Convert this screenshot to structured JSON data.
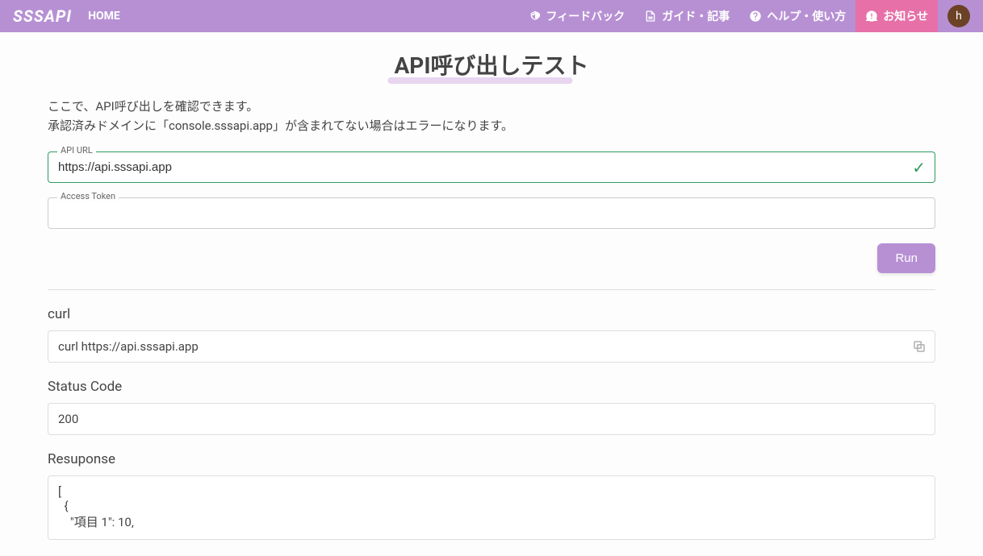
{
  "header": {
    "logo": "SSSAPI",
    "home": "HOME",
    "nav": {
      "feedback": "フィードバック",
      "guide": "ガイド・記事",
      "help": "ヘルプ・使い方",
      "news": "お知らせ"
    },
    "avatar_letter": "h"
  },
  "page": {
    "title": "API呼び出しテスト",
    "desc_line1": "ここで、API呼び出しを確認できます。",
    "desc_line2": "承認済みドメインに「console.sssapi.app」が含まれてない場合はエラーになります。"
  },
  "form": {
    "api_url_label": "API URL",
    "api_url_value": "https://api.sssapi.app",
    "access_token_label": "Access Token",
    "access_token_value": "",
    "run_button": "Run"
  },
  "output": {
    "curl_label": "curl",
    "curl_value": "curl https://api.sssapi.app",
    "status_label": "Status Code",
    "status_value": "200",
    "response_label": "Resuponse",
    "response_value": "[\n  {\n    \"項目 1\": 10,"
  }
}
